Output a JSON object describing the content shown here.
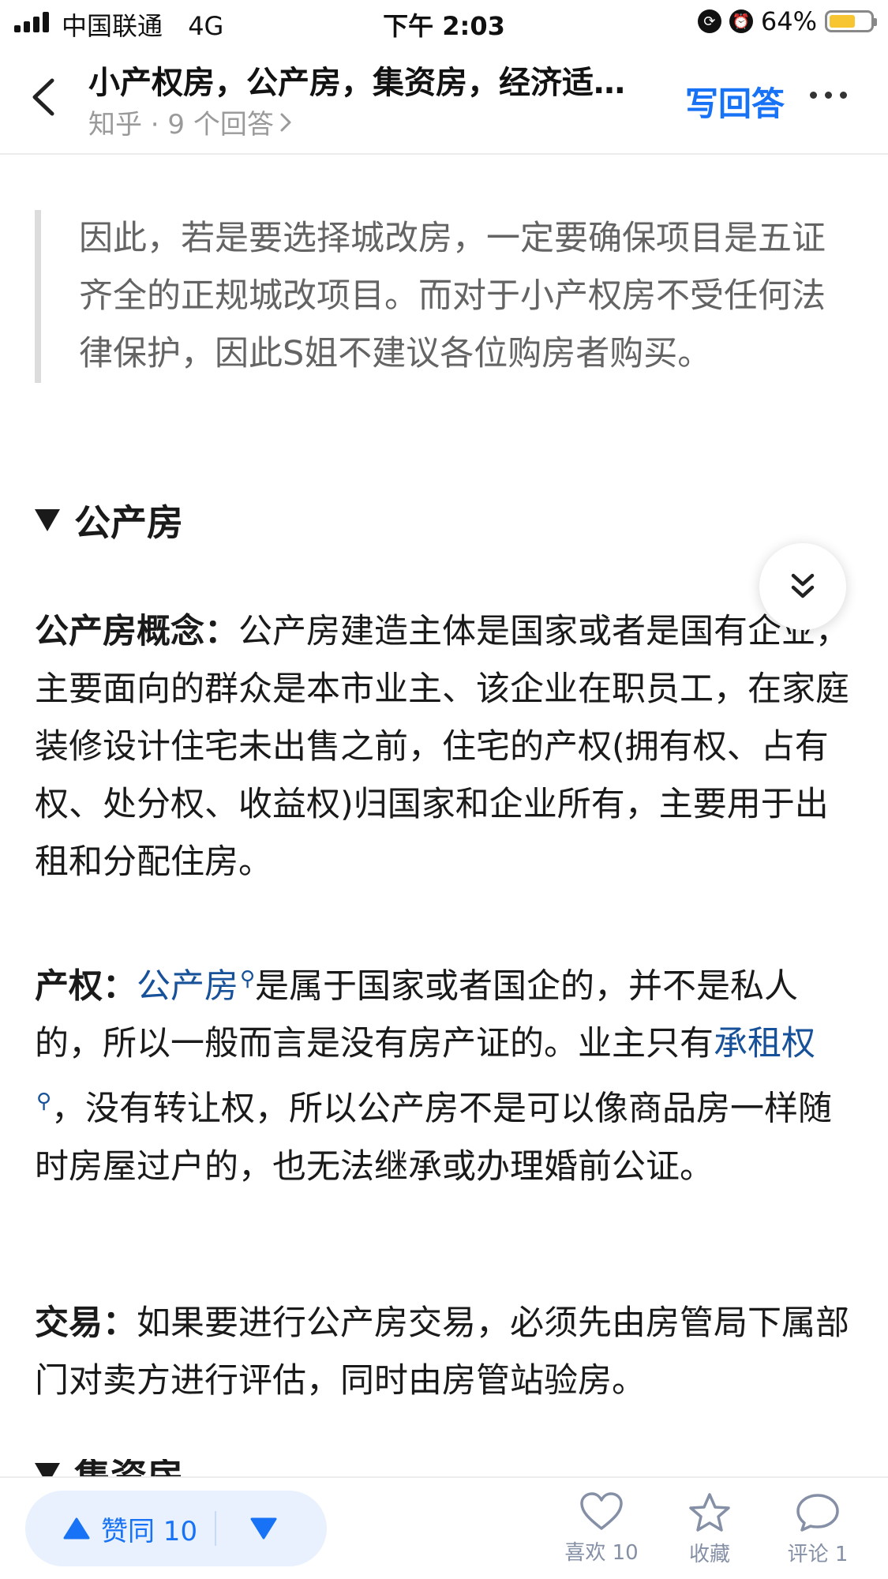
{
  "status_bar": {
    "carrier": "中国联通",
    "network": "4G",
    "time": "下午 2:03",
    "battery_percent": "64%",
    "battery_level": 0.64,
    "battery_color": "#f6c531"
  },
  "nav": {
    "title": "小产权房，公产房，集资房，经济适…",
    "source": "知乎 · 9 个回答",
    "write_answer": "写回答"
  },
  "quote": {
    "text": "因此，若是要选择城改房，一定要确保项目是五证齐全的正规城改项目。而对于小产权房不受任何法律保护，因此S姐不建议各位购房者购买。"
  },
  "section": {
    "heading": "公产房"
  },
  "paragraphs": {
    "concept_label": "公产房概念：",
    "concept_text": "公产房建造主体是国家或者是国有企业，主要面向的群众是本市业主、该企业在职员工，在家庭装修设计住宅未出售之前，住宅的产权(拥有权、占有权、处分权、收益权)归国家和企业所有，主要用于出租和分配住房。",
    "property_label": "产权：",
    "property_link1": "公产房",
    "property_text1": "是属于国家或者国企的，并不是私人的，所以一般而言是没有房产证的。业主只有",
    "property_link2": "承租权",
    "property_text2": "，没有转让权，所以公产房不是可以像商品房一样随时房屋过户的，也无法继承或办理婚前公证。",
    "trade_label": "交易：",
    "trade_text": "如果要进行公产房交易，必须先由房管局下属部门对卖方进行评估，同时由房管站验房。"
  },
  "next_section": {
    "heading": "集资房"
  },
  "bottom_bar": {
    "upvote_label": "赞同 10",
    "like_label": "喜欢 10",
    "favorite_label": "收藏",
    "comment_label": "评论 1"
  },
  "colors": {
    "accent": "#1772f6",
    "link": "#175199",
    "vote_bg": "#e8f1fd"
  },
  "icons": {
    "back": "chevron-left-icon",
    "more": "more-horizontal-icon",
    "scroll": "double-chevron-down-icon",
    "like": "heart-icon",
    "favorite": "star-icon",
    "comment": "comment-bubble-icon"
  }
}
